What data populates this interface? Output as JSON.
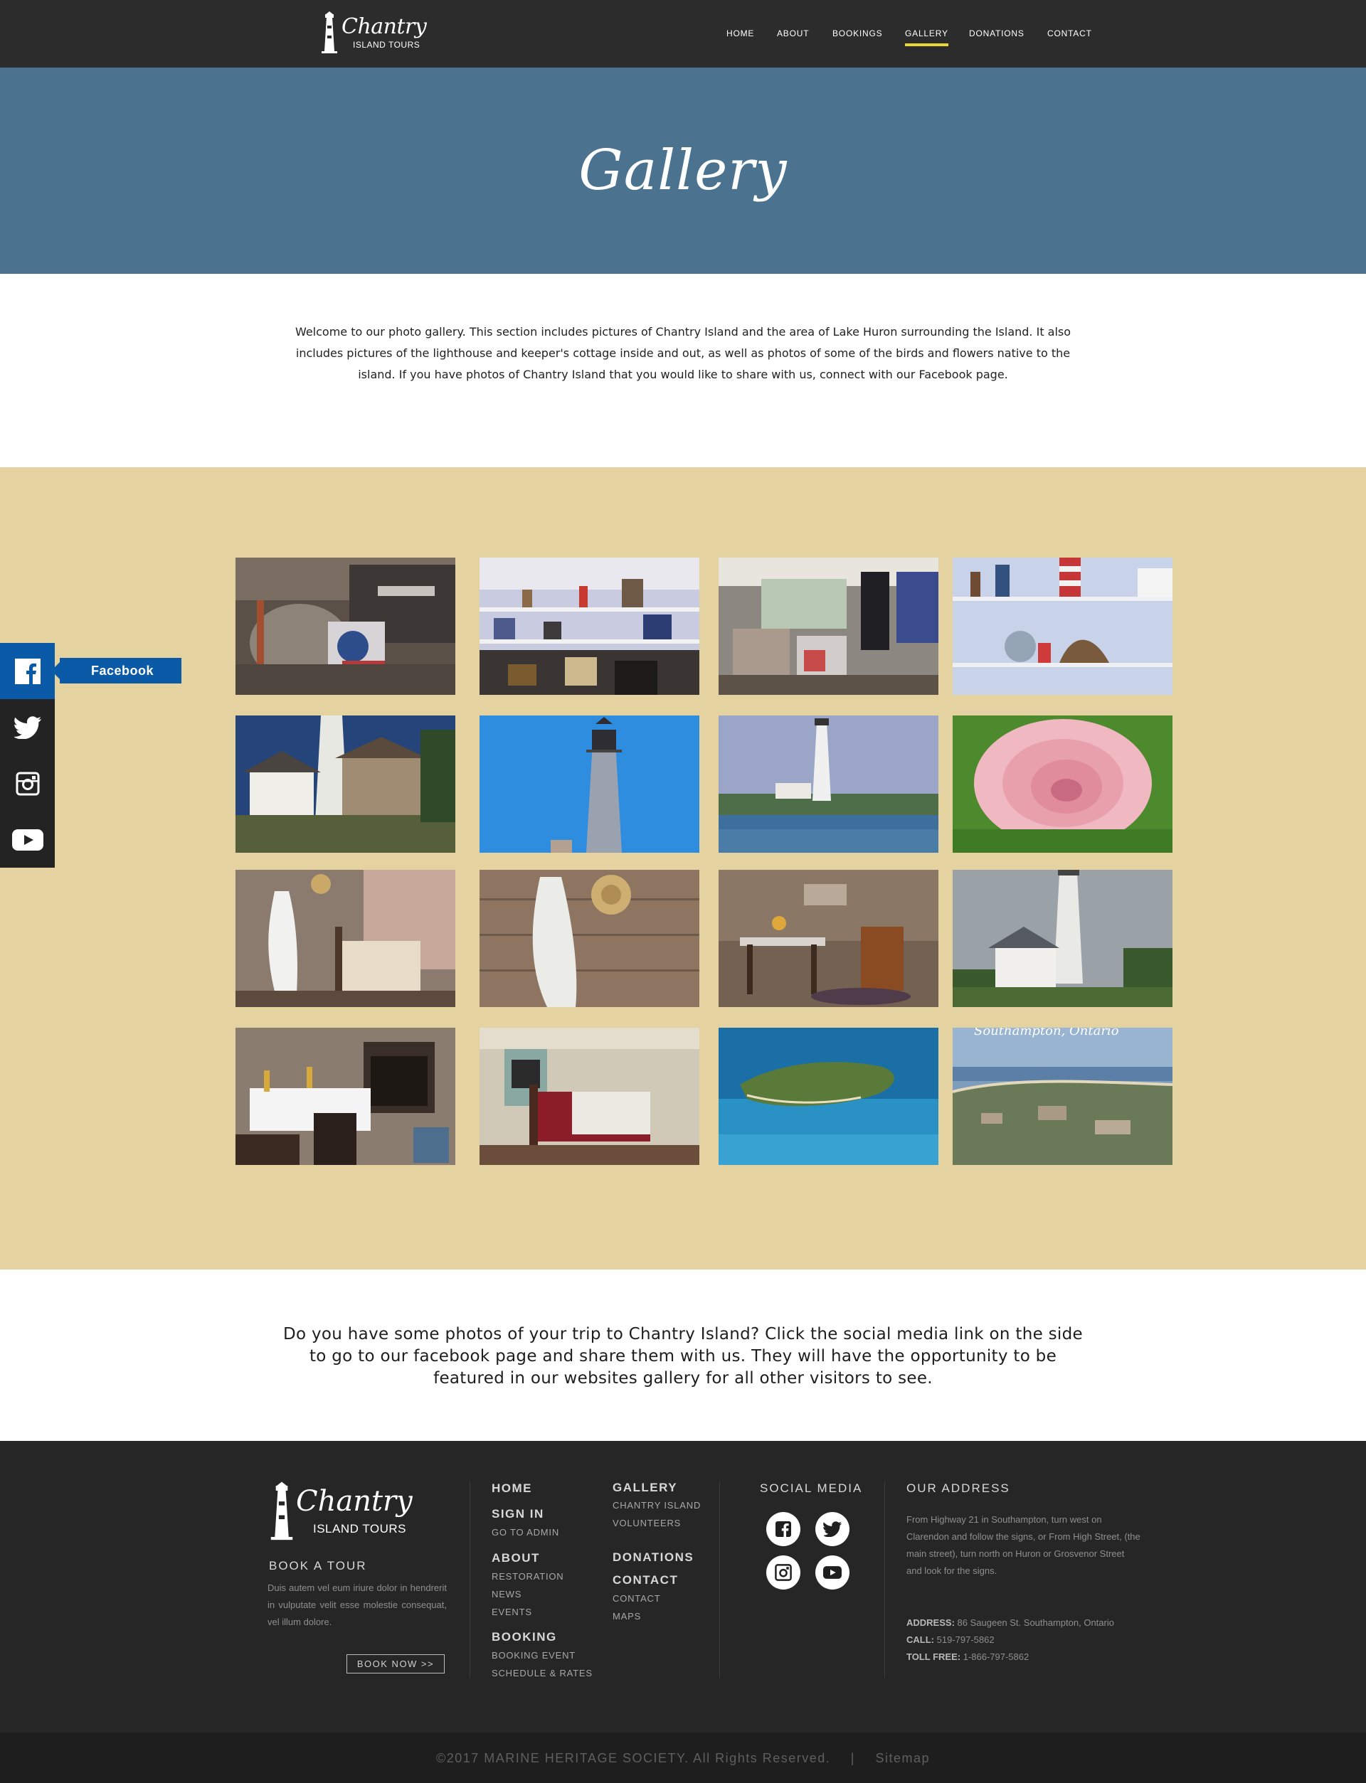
{
  "brand": {
    "logo_script": "Chantry",
    "logo_sub": "ISLAND TOURS"
  },
  "nav": {
    "items": [
      "HOME",
      "ABOUT",
      "BOOKINGS",
      "GALLERY",
      "DONATIONS",
      "CONTACT"
    ],
    "active": "GALLERY",
    "accent": "#e8d832"
  },
  "hero": {
    "title": "Gallery",
    "bg": "#4b7390"
  },
  "intro": {
    "text": "Welcome to our photo gallery. This section includes pictures of Chantry Island and the area of Lake Huron surrounding the Island. It also includes pictures of the lighthouse and keeper's cottage inside and out, as well as photos of some of the birds and flowers native to the island. If you have photos of Chantry Island that you would like to share with us, connect with our Facebook page."
  },
  "gallery": {
    "bg": "#e5d2a1",
    "photos": [
      "gift-shop-clutter",
      "gift-shop-shelves",
      "gift-shop-window",
      "gift-shop-lighthouses",
      "lighthouse-and-shed",
      "lighthouse-tower-blue-sky",
      "lighthouse-across-water",
      "pink-rose",
      "bedroom-coat-hook",
      "stone-wall-coat",
      "dining-room-chairs",
      "lighthouse-cottage",
      "table-set-fireplace",
      "bedroom-quilt",
      "aerial-island",
      "aerial-town"
    ],
    "aerial_caption": "Southampton, Ontario"
  },
  "side_social": {
    "active_label": "Facebook",
    "items": [
      "facebook-icon",
      "twitter-icon",
      "instagram-icon",
      "youtube-icon"
    ],
    "fb_color": "#0b5aa8"
  },
  "share": {
    "text": "Do you have some photos of your trip to Chantry Island? Click the social media link on the side to go to our facebook page and share them with us. They will have the opportunity to be featured in our websites gallery for all other visitors to see."
  },
  "footer": {
    "book_title": "BOOK A TOUR",
    "book_text": "Duis autem vel eum iriure dolor in hendrerit in vulputate velit esse molestie consequat, vel illum dolore.",
    "book_button": "BOOK NOW >>",
    "col1": {
      "home": "HOME",
      "signin": "SIGN IN",
      "signin_links": [
        "GO TO ADMIN"
      ],
      "about": "ABOUT",
      "about_links": [
        "RESTORATION",
        "NEWS",
        "EVENTS"
      ],
      "booking": "BOOKING",
      "booking_links": [
        "BOOKING EVENT",
        "SCHEDULE & RATES"
      ]
    },
    "col2": {
      "gallery": "GALLERY",
      "gallery_links": [
        "CHANTRY ISLAND",
        "VOLUNTEERS"
      ],
      "donations": "DONATIONS",
      "contact": "CONTACT",
      "contact_links": [
        "CONTACT",
        "MAPS"
      ]
    },
    "social_title": "SOCIAL MEDIA",
    "address_title": "OUR ADDRESS",
    "directions": "From Highway 21 in Southampton, turn west on Clarendon and follow the signs, or From High Street, (the main street), turn north on Huron or Grosvenor Street and look for the signs.",
    "address_label": "ADDRESS:",
    "address": "86 Saugeen St. Southampton, Ontario",
    "call_label": "CALL:",
    "call": "519-797-5862",
    "tollfree_label": "TOLL FREE:",
    "tollfree": "1-866-797-5862"
  },
  "copyright": {
    "text": "©2017 MARINE HERITAGE SOCIETY. All Rights Reserved.",
    "separator": "|",
    "sitemap": "Sitemap"
  }
}
